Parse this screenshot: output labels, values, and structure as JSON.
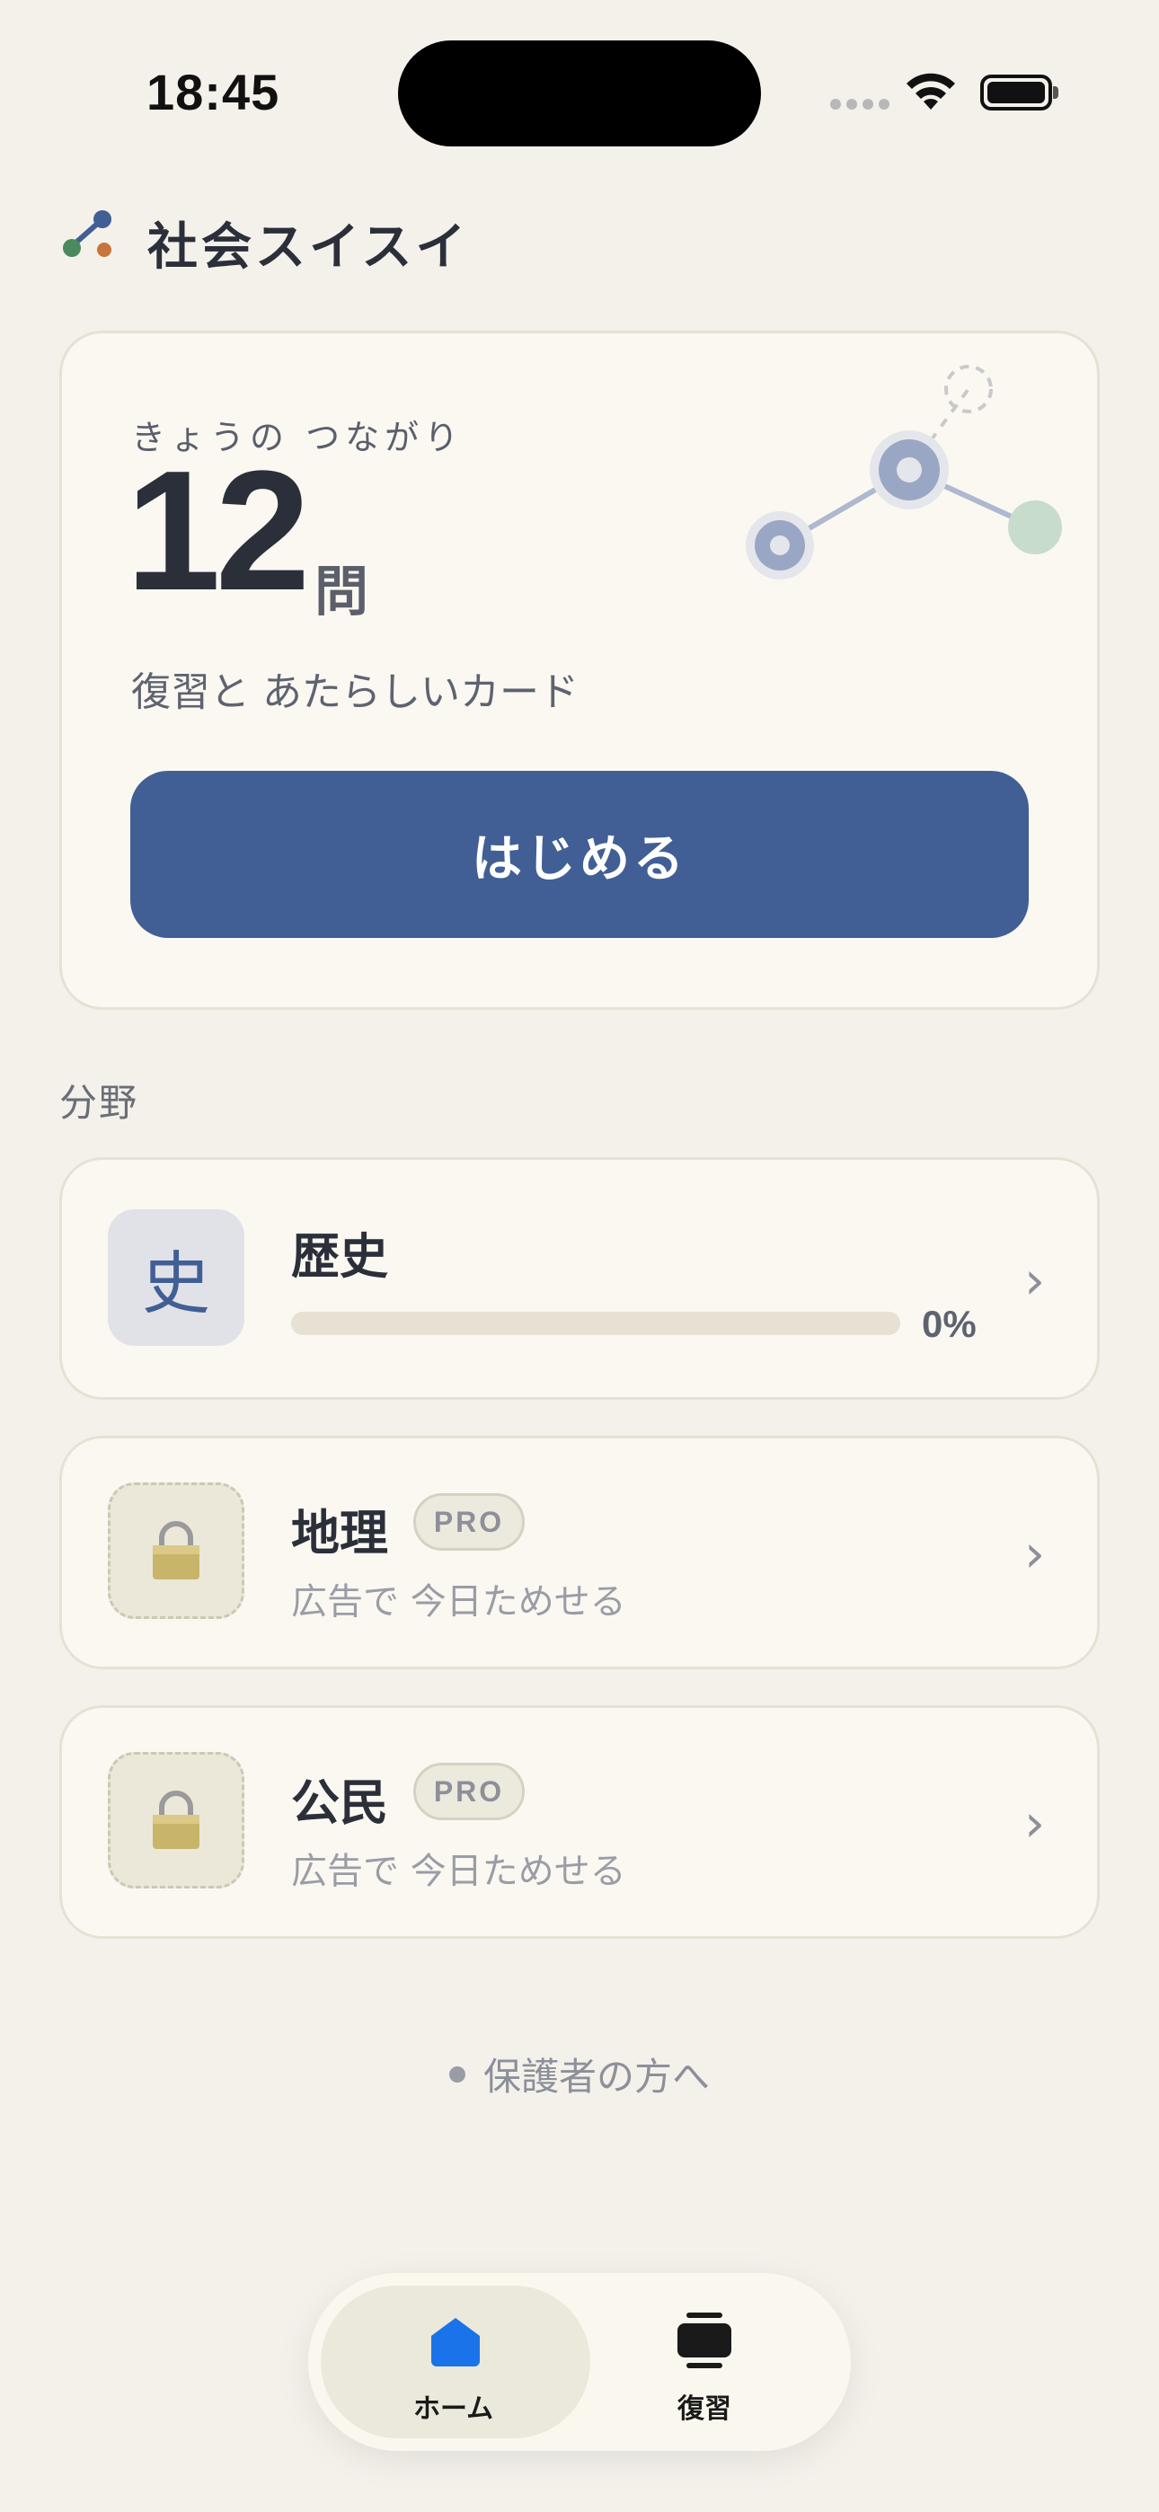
{
  "status_bar": {
    "time": "18:45"
  },
  "header": {
    "app_title": "社会スイスイ",
    "logo_icon": "connected-dots-logo-icon"
  },
  "hero": {
    "kicker": "きょうの つながり",
    "count": "12",
    "unit": "問",
    "subtitle": "復習と あたらしいカード",
    "start_label": "はじめる",
    "accent_color": "#415f95"
  },
  "section": {
    "label": "分野"
  },
  "subjects": [
    {
      "icon_char": "史",
      "name": "歴史",
      "progress_label": "0%",
      "progress": 0,
      "locked": false
    },
    {
      "icon": "lock-icon",
      "name": "地理",
      "badge": "PRO",
      "subtitle": "広告で 今日ためせる",
      "locked": true
    },
    {
      "icon": "lock-icon",
      "name": "公民",
      "badge": "PRO",
      "subtitle": "広告で 今日ためせる",
      "locked": true
    }
  ],
  "parents_link": {
    "label": "保護者の方へ"
  },
  "tabbar": {
    "tabs": [
      {
        "label": "ホーム",
        "icon": "home-icon",
        "active": true,
        "color": "#1a73e8"
      },
      {
        "label": "復習",
        "icon": "cards-stack-icon",
        "active": false
      }
    ]
  }
}
